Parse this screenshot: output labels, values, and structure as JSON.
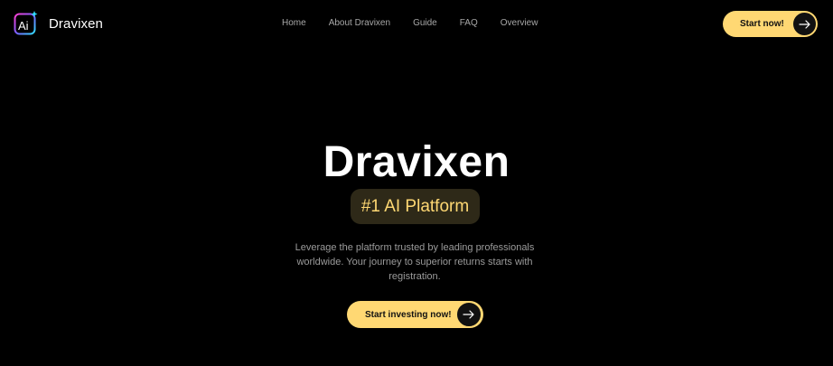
{
  "header": {
    "brand": "Dravixen",
    "logo_letters": "Ai",
    "nav": [
      "Home",
      "About Dravixen",
      "Guide",
      "FAQ",
      "Overview"
    ],
    "cta_label": "Start now!"
  },
  "hero": {
    "title": "Dravixen",
    "badge": "#1 AI Platform",
    "description": "Leverage the platform trusted by leading professionals worldwide. Your journey to superior returns starts with registration.",
    "cta_label": "Start investing now!"
  },
  "colors": {
    "background": "#000000",
    "accent": "#ffd873",
    "badge_bg": "#2e2918",
    "muted_text": "#9b9b9b"
  },
  "icons": {
    "logo": "ai-logo-icon",
    "arrow": "arrow-right-icon"
  }
}
